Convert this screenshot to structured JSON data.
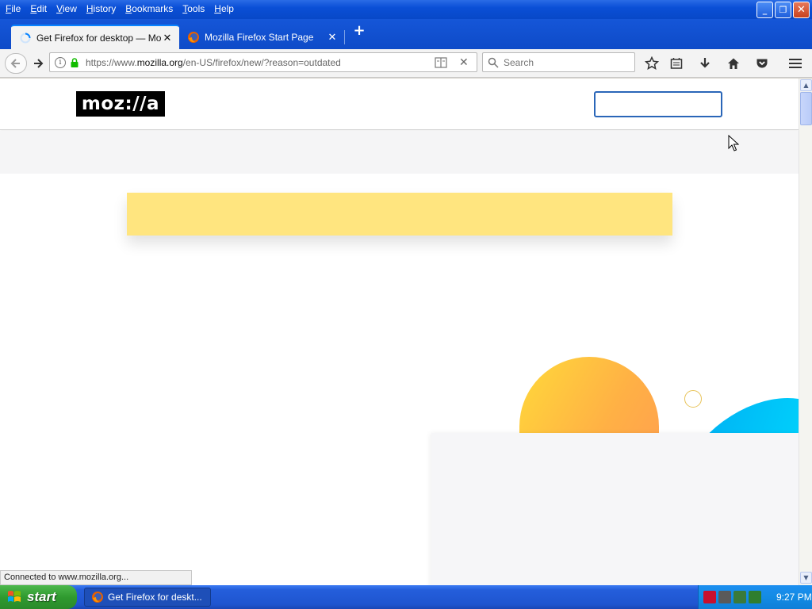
{
  "menubar": {
    "items": [
      "File",
      "Edit",
      "View",
      "History",
      "Bookmarks",
      "Tools",
      "Help"
    ]
  },
  "tabs": [
    {
      "label": "Get Firefox for desktop — Mo...",
      "active": true
    },
    {
      "label": "Mozilla Firefox Start Page",
      "active": false
    }
  ],
  "navbar": {
    "url_prefix": "https://www.",
    "url_domain": "mozilla.org",
    "url_path": "/en-US/firefox/new/?reason=outdated",
    "search_placeholder": "Search"
  },
  "page": {
    "logo_text": "moz://a",
    "status_text": "Connected to www.mozilla.org...",
    "colors": {
      "banner": "#ffe57f",
      "accent_blue": "#00b3f4",
      "accent_orange": "#ffb045"
    }
  },
  "taskbar": {
    "start_label": "start",
    "task_label": "Get Firefox for deskt...",
    "clock": "9:27 PM"
  }
}
